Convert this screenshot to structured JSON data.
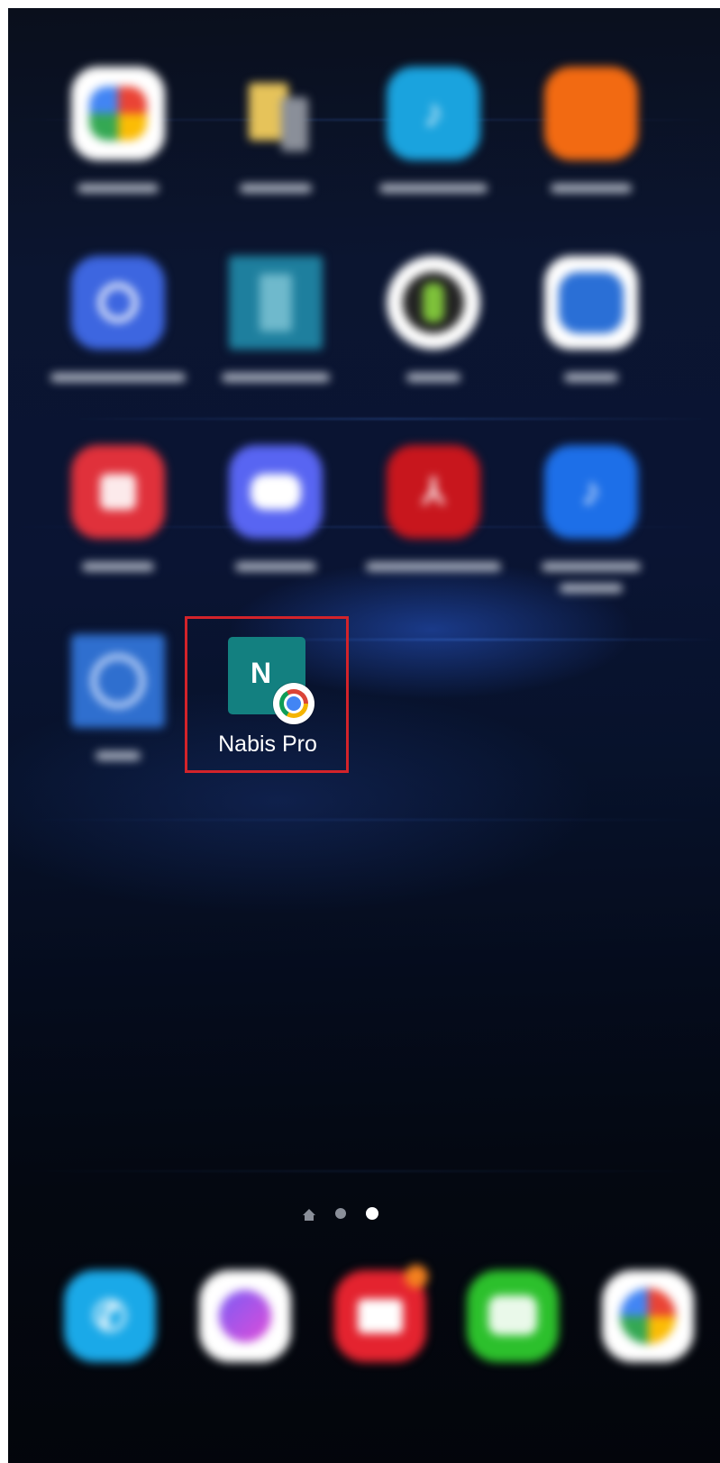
{
  "highlighted_app": {
    "label": "Nabis Pro",
    "icon_letter": "N",
    "icon_color": "#138080",
    "badge": "chrome-icon"
  },
  "highlight_color": "#d3232a",
  "page_indicator": {
    "pages": 3,
    "current": 3
  },
  "blurred_apps": [
    {
      "icon": "google-home-icon",
      "color": "#ffffff"
    },
    {
      "icon": "folder-icon",
      "color": "#e6c35a"
    },
    {
      "icon": "music-app-icon",
      "color": "#1aa3de"
    },
    {
      "icon": "orange-app-icon",
      "color": "#f26a12"
    },
    {
      "icon": "bixby-icon",
      "color": "#3d66e0"
    },
    {
      "icon": "document-app-icon",
      "color": "#1e7f9e"
    },
    {
      "icon": "android-icon",
      "color": "#ffffff"
    },
    {
      "icon": "gallery-icon",
      "color": "#2a6fd6"
    },
    {
      "icon": "red-app-icon",
      "color": "#e0313b"
    },
    {
      "icon": "discord-icon",
      "color": "#5865f2"
    },
    {
      "icon": "adobe-acrobat-icon",
      "color": "#c8161d"
    },
    {
      "icon": "samsung-music-icon",
      "color": "#1d6fe8"
    },
    {
      "icon": "blue-app-icon",
      "color": "#2f6fcf"
    }
  ],
  "dock": [
    {
      "icon": "phone-icon",
      "color": "#1aa9e8"
    },
    {
      "icon": "messenger-icon",
      "color": "#ffffff"
    },
    {
      "icon": "email-icon",
      "color": "#e4232f"
    },
    {
      "icon": "messages-icon",
      "color": "#2cc02c"
    },
    {
      "icon": "photos-icon",
      "color": "#ffffff"
    }
  ]
}
